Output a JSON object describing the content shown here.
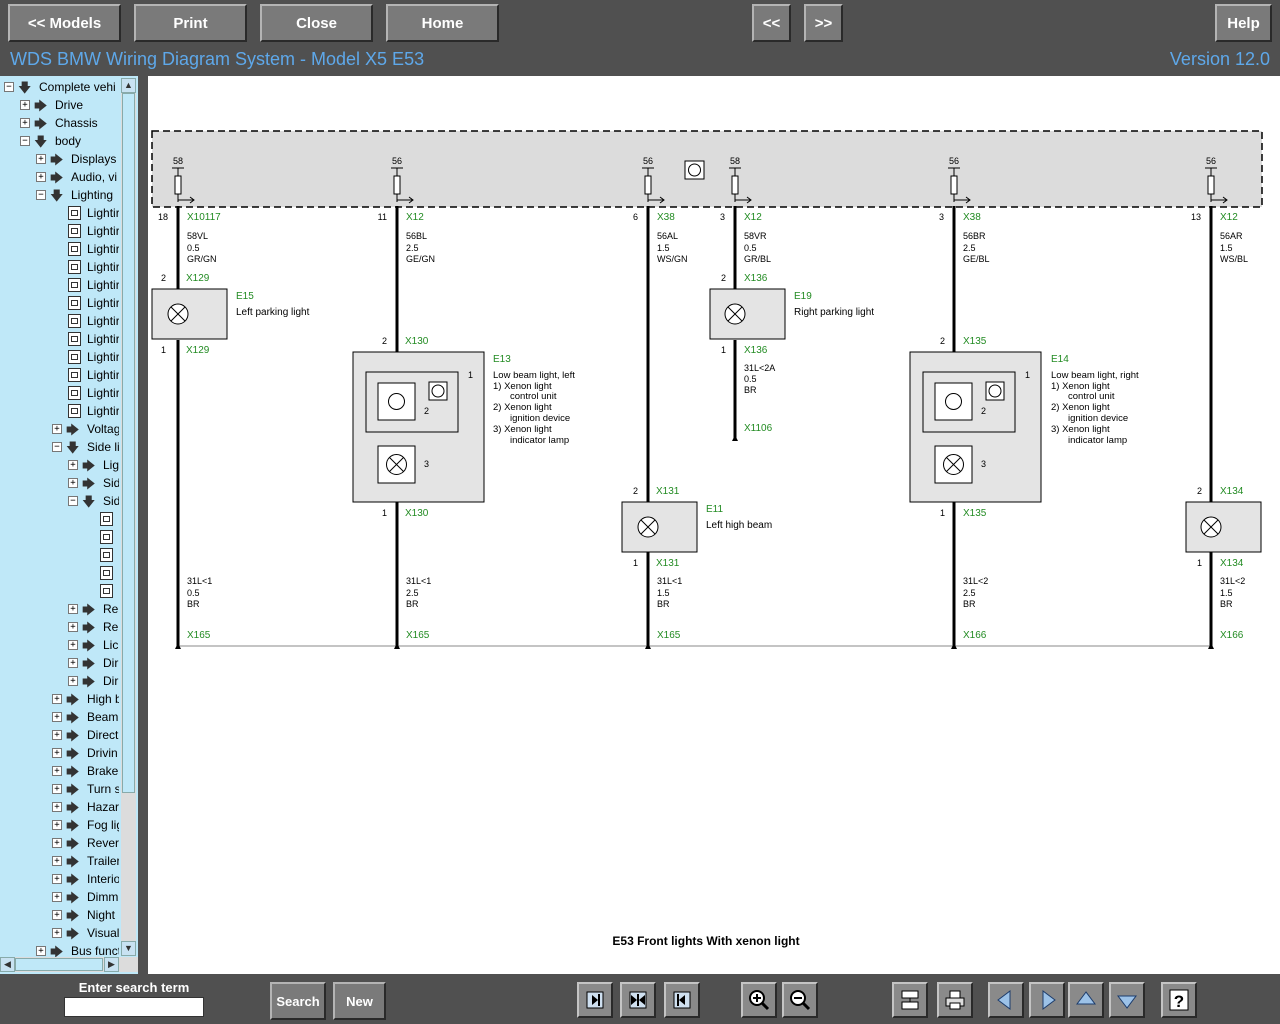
{
  "toolbar": {
    "models": "<< Models",
    "print": "Print",
    "close": "Close",
    "home": "Home",
    "prev": "<<",
    "next": ">>",
    "help": "Help"
  },
  "header": {
    "title": "WDS BMW Wiring Diagram System - Model X5 E53",
    "version": "Version 12.0"
  },
  "tree": {
    "complete": "Complete vehi",
    "drive": "Drive",
    "chassis": "Chassis",
    "body": "body",
    "displays": "Displays",
    "audio": "Audio, vi",
    "lighting": "Lighting",
    "lighting_item": "Lightir",
    "voltage": "Voltag",
    "side": "Side li",
    "lig": "Lig",
    "sid": "Sid",
    "re": "Re",
    "lic": "Lic",
    "dir": "Dir",
    "high": "High b",
    "beam": "Beam",
    "direct": "Direct",
    "drivin": "Drivin",
    "brake": "Brake",
    "turn": "Turn s",
    "hazar": "Hazar",
    "fog": "Fog lig",
    "rever": "Rever",
    "trailer": "Trailer",
    "interior": "Interio",
    "dimm": "Dimm",
    "night": "Night",
    "visual": "Visual",
    "bus": "Bus funct"
  },
  "diagram": {
    "caption": "E53 Front lights With xenon light",
    "fuses": [
      "58",
      "56",
      "56",
      "58",
      "56",
      "56"
    ],
    "wires_top": [
      {
        "pin": "18",
        "conn": "X10117",
        "code": "58VL",
        "size": "0.5",
        "color": "GR/GN"
      },
      {
        "pin": "11",
        "conn": "X12",
        "code": "56BL",
        "size": "2.5",
        "color": "GE/GN"
      },
      {
        "pin": "6",
        "conn": "X38",
        "code": "56AL",
        "size": "1.5",
        "color": "WS/GN"
      },
      {
        "pin": "3",
        "conn": "X12",
        "code": "58VR",
        "size": "0.5",
        "color": "GR/BL"
      },
      {
        "pin": "3",
        "conn": "X38",
        "code": "56BR",
        "size": "2.5",
        "color": "GE/BL"
      },
      {
        "pin": "13",
        "conn": "X12",
        "code": "56AR",
        "size": "1.5",
        "color": "WS/BL"
      }
    ],
    "components": {
      "e15": {
        "id": "E15",
        "name": "Left parking light",
        "pin_in": "2",
        "conn_in": "X129",
        "pin_out": "1",
        "conn_out": "X129"
      },
      "e19": {
        "id": "E19",
        "name": "Right parking light",
        "pin_in": "2",
        "conn_in": "X136",
        "pin_out": "1",
        "conn_out": "X136"
      },
      "e11": {
        "id": "E11",
        "name": "Left high beam",
        "pin_in": "2",
        "conn_in": "X131",
        "pin_out": "1",
        "conn_out": "X131"
      },
      "e13": {
        "id": "E13",
        "title": "Low beam light, left",
        "l1": "1) Xenon light",
        "l1b": "control unit",
        "l2": "2) Xenon light",
        "l2b": "ignition device",
        "l3": "3) Xenon light",
        "l3b": "indicator lamp",
        "pin_in": "2",
        "conn_in": "X130",
        "pin_out": "1",
        "conn_out": "X130",
        "n1": "1",
        "n2": "2",
        "n3": "3"
      },
      "e14": {
        "id": "E14",
        "title": "Low beam light, right",
        "l1": "1) Xenon light",
        "l1b": "control unit",
        "l2": "2) Xenon light",
        "l2b": "ignition device",
        "l3": "3) Xenon light",
        "l3b": "indicator lamp",
        "pin_in": "2",
        "conn_in": "X135",
        "pin_out": "1",
        "conn_out": "X135",
        "n1": "1",
        "n2": "2",
        "n3": "3"
      },
      "x134": {
        "pin_in": "2",
        "conn_in": "X134",
        "pin_out": "1",
        "conn_out": "X134"
      }
    },
    "e19_ground": {
      "code": "31L<2A",
      "size": "0.5",
      "color": "BR",
      "conn": "X1106"
    },
    "wires_bottom": [
      {
        "code": "31L<1",
        "size": "0.5",
        "color": "BR",
        "conn": "X165"
      },
      {
        "code": "31L<1",
        "size": "2.5",
        "color": "BR",
        "conn": "X165"
      },
      {
        "code": "31L<1",
        "size": "1.5",
        "color": "BR",
        "conn": "X165"
      },
      {
        "code": "31L<2",
        "size": "2.5",
        "color": "BR",
        "conn": "X166"
      },
      {
        "code": "31L<2",
        "size": "1.5",
        "color": "BR",
        "conn": "X166"
      }
    ]
  },
  "bottom": {
    "search_label": "Enter search term",
    "search_value": "",
    "search_btn": "Search",
    "new_btn": "New"
  }
}
